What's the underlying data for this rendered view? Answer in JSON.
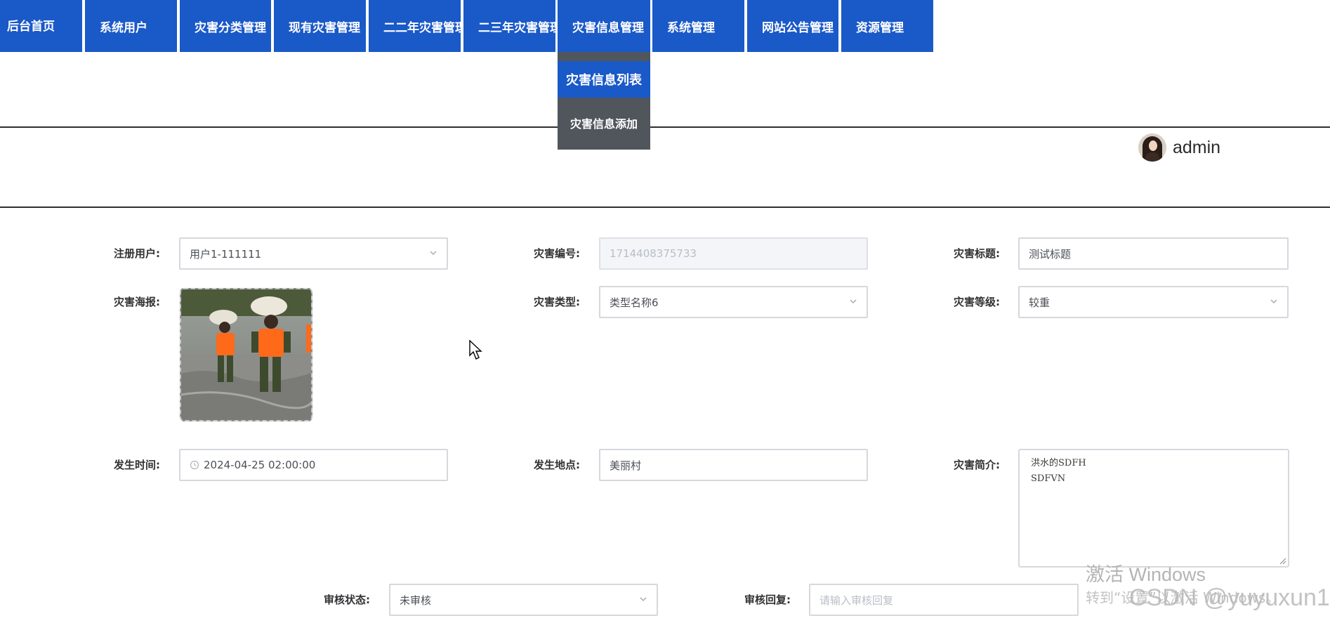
{
  "nav": {
    "items": [
      {
        "label": "后台首页"
      },
      {
        "label": "系统用户"
      },
      {
        "label": "灾害分类管理"
      },
      {
        "label": "现有灾害管理"
      },
      {
        "label": "二二年灾害管理"
      },
      {
        "label": "二三年灾害管理"
      },
      {
        "label": "灾害信息管理"
      },
      {
        "label": "系统管理"
      },
      {
        "label": "网站公告管理"
      },
      {
        "label": "资源管理"
      }
    ],
    "accent_color": "#1a59c8",
    "dropdown": {
      "items": [
        {
          "label": "灾害信息列表",
          "active": true
        },
        {
          "label": "灾害信息添加",
          "active": false
        }
      ]
    }
  },
  "header": {
    "username": "admin"
  },
  "form": {
    "register_user": {
      "label": "注册用户:",
      "value": "用户1-111111"
    },
    "disaster_no": {
      "label": "灾害编号:",
      "value": "1714408375733"
    },
    "disaster_title": {
      "label": "灾害标题:",
      "value": "测试标题"
    },
    "disaster_poster": {
      "label": "灾害海报:"
    },
    "disaster_type": {
      "label": "灾害类型:",
      "value": "类型名称6"
    },
    "disaster_level": {
      "label": "灾害等级:",
      "value": "较重"
    },
    "occur_time": {
      "label": "发生时间:",
      "value": "2024-04-25 02:00:00"
    },
    "occur_place": {
      "label": "发生地点:",
      "value": "美丽村"
    },
    "disaster_intro": {
      "label": "灾害简介:",
      "lines": [
        "洪水的SDFH",
        "SDFVN"
      ]
    },
    "review_status": {
      "label": "审核状态:",
      "value": "未审核"
    },
    "review_reply": {
      "label": "审核回复:",
      "placeholder": "请输入审核回复"
    }
  },
  "watermark": {
    "title": "激活 Windows",
    "subtitle": "转到“设置”以激活 Windows。",
    "csdn": "CSDN @yuyuxun1"
  }
}
